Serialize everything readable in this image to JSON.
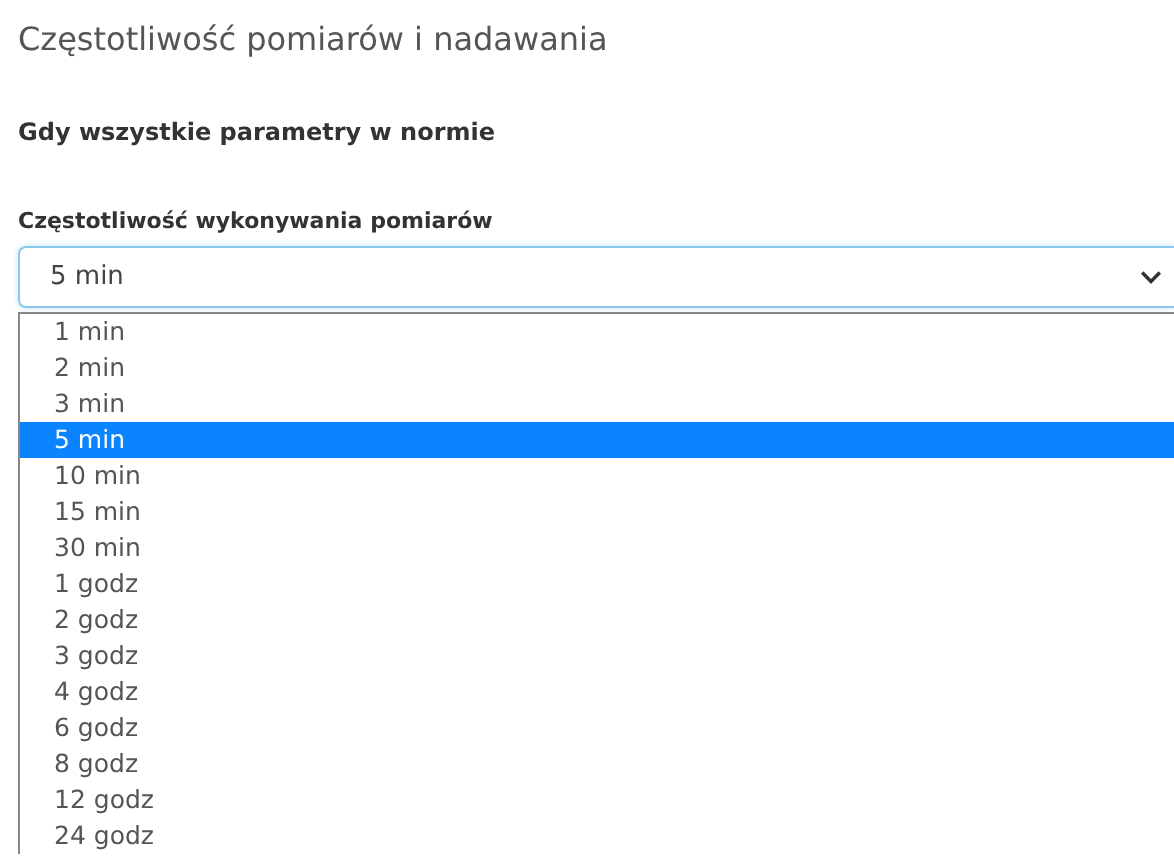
{
  "heading": "Częstotliwość pomiarów i nadawania",
  "section": "Gdy wszystkie parametry w normie",
  "field": {
    "label": "Częstotliwość wykonywania pomiarów",
    "value": "5 min",
    "expanded": true
  },
  "options": [
    {
      "label": "1 min",
      "selected": false
    },
    {
      "label": "2 min",
      "selected": false
    },
    {
      "label": "3 min",
      "selected": false
    },
    {
      "label": "5 min",
      "selected": true
    },
    {
      "label": "10 min",
      "selected": false
    },
    {
      "label": "15 min",
      "selected": false
    },
    {
      "label": "30 min",
      "selected": false
    },
    {
      "label": "1 godz",
      "selected": false
    },
    {
      "label": "2 godz",
      "selected": false
    },
    {
      "label": "3 godz",
      "selected": false
    },
    {
      "label": "4 godz",
      "selected": false
    },
    {
      "label": "6 godz",
      "selected": false
    },
    {
      "label": "8 godz",
      "selected": false
    },
    {
      "label": "12 godz",
      "selected": false
    },
    {
      "label": "24 godz",
      "selected": false
    }
  ]
}
